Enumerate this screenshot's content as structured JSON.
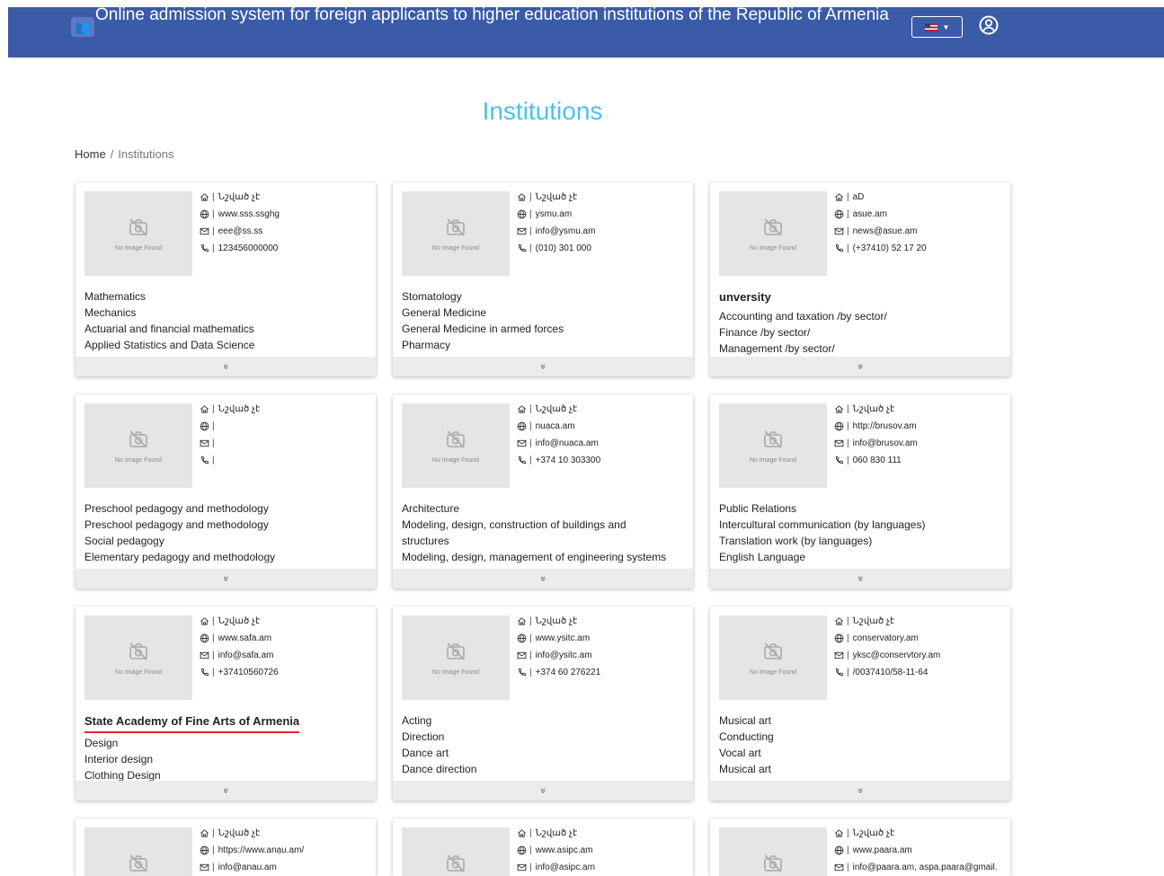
{
  "header": {
    "title": "Online admission system for foreign applicants to higher education institutions of the Republic of Armenia",
    "language": "flag-us",
    "accent": "#3a5ba8"
  },
  "page": {
    "title": "Institutions",
    "title_color": "#4cc3e6"
  },
  "breadcrumb": {
    "home": "Home",
    "separator": "/",
    "current": "Institutions"
  },
  "thumb_text": "No Image Found",
  "expand_icon": "»",
  "cards": [
    {
      "address": "Նշված չէ",
      "website": "www.sss.ssghg",
      "email": "eee@ss.ss",
      "phone": "123456000000",
      "heading": "",
      "programs": [
        "Mathematics",
        "Mechanics",
        "Actuarial and financial mathematics",
        "Applied Statistics and Data Science"
      ]
    },
    {
      "address": "Նշված չէ",
      "website": "ysmu.am",
      "email": "info@ysmu.am",
      "phone": "(010) 301 000",
      "heading": "",
      "programs": [
        "Stomatology",
        "General Medicine",
        "General Medicine in armed forces",
        "Pharmacy"
      ]
    },
    {
      "address": "aD",
      "website": "asue.am",
      "email": "news@asue.am",
      "phone": "(+37410) 52 17 20",
      "heading": "unversity",
      "programs": [
        "Accounting and taxation /by sector/",
        "Finance /by sector/",
        "Management /by sector/"
      ]
    },
    {
      "address": "Նշված չէ",
      "website": "",
      "email": "",
      "phone": "",
      "heading": "",
      "programs": [
        "Preschool pedagogy and methodology",
        "Preschool pedagogy and methodology",
        "Social pedagogy",
        "Elementary pedagogy and methodology"
      ]
    },
    {
      "address": "Նշված չէ",
      "website": "nuaca.am",
      "email": "info@nuaca.am",
      "phone": "+374 10 303300",
      "heading": "",
      "programs": [
        "Architecture",
        "Modeling, design, construction of buildings and",
        "structures",
        "Modeling, design, management of engineering systems"
      ]
    },
    {
      "address": "Նշված չէ",
      "website": "http://brusov.am",
      "email": "info@brusov.am",
      "phone": "060 830 111",
      "heading": "",
      "programs": [
        "Public Relations",
        "Intercultural communication (by languages)",
        "Translation work (by languages)",
        "English Language"
      ]
    },
    {
      "address": "Նշված չէ",
      "website": "www.safa.am",
      "email": "info@safa.am",
      "phone": "+37410560726",
      "heading": "State Academy of Fine Arts of Armenia",
      "programs": [
        "Design",
        "Interior design",
        "Clothing Design"
      ]
    },
    {
      "address": "Նշված չէ",
      "website": "www.ysitc.am",
      "email": "info@ysitc.am",
      "phone": "+374 60 276221",
      "heading": "",
      "programs": [
        "Acting",
        "Direction",
        "Dance art",
        "Dance direction"
      ]
    },
    {
      "address": "Նշված չէ",
      "website": "conservatory.am",
      "email": "yksc@conservtory.am",
      "phone": "/0037410/58-11-64",
      "heading": "",
      "programs": [
        "Musical art",
        "Conducting",
        "Vocal art",
        "Musical art"
      ]
    },
    {
      "address": "Նշված չէ",
      "website": "https://www.anau.am/",
      "email": "info@anau.am"
    },
    {
      "address": "Նշված չէ",
      "website": "www.asipc.am",
      "email": "info@asipc.am"
    },
    {
      "address": "Նշված չէ",
      "website": "www.paara.am",
      "email": "info@paara.am, aspa.paara@gmail."
    }
  ]
}
